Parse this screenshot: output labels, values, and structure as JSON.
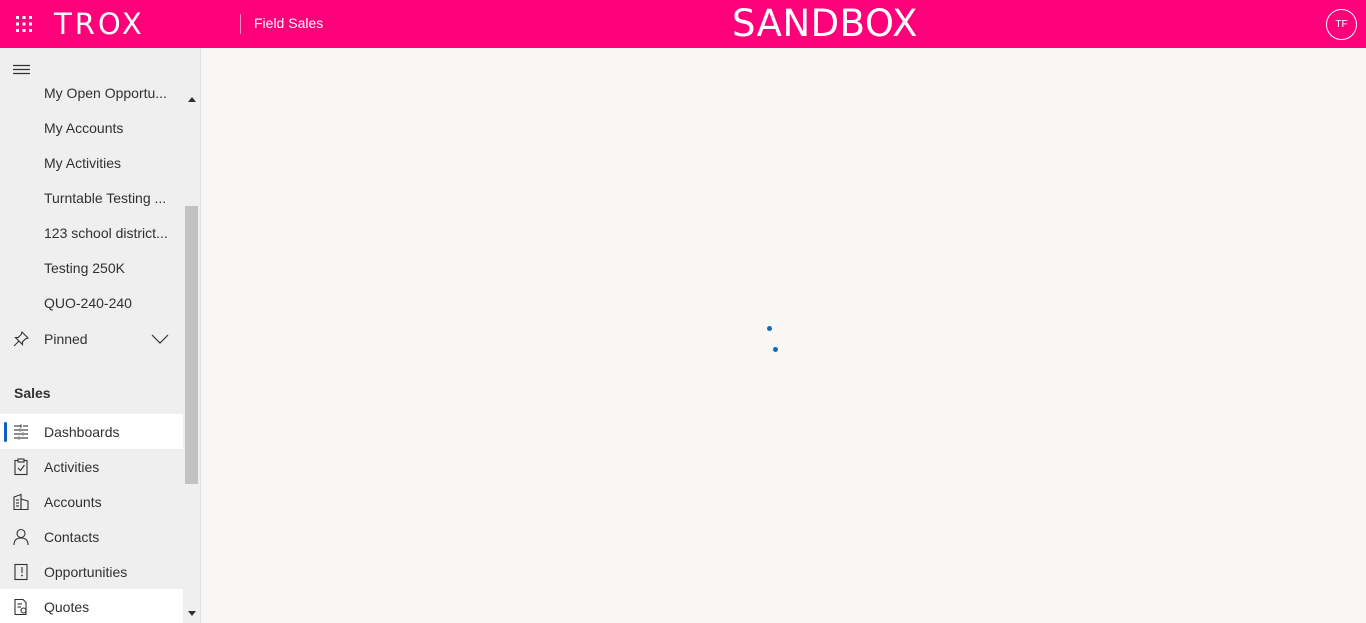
{
  "header": {
    "logo_text": "TROX",
    "app_name": "Field Sales",
    "environment_label": "SANDBOX",
    "avatar_initials": "TF",
    "brand_color": "#ff007b",
    "waffle_icon": "app-launcher-icon"
  },
  "sidebar": {
    "recent_items": [
      {
        "label": "My Open Opportu..."
      },
      {
        "label": "My Accounts"
      },
      {
        "label": "My Activities"
      },
      {
        "label": "Turntable Testing ..."
      },
      {
        "label": "123 school district..."
      },
      {
        "label": "Testing 250K"
      },
      {
        "label": "QUO-240-240"
      }
    ],
    "pinned": {
      "label": "Pinned",
      "icon": "pin-icon"
    },
    "section_title": "Sales",
    "sales_items": [
      {
        "label": "Dashboards",
        "icon": "dashboard-icon",
        "active": true
      },
      {
        "label": "Activities",
        "icon": "activities-icon"
      },
      {
        "label": "Accounts",
        "icon": "accounts-icon"
      },
      {
        "label": "Contacts",
        "icon": "contact-icon"
      },
      {
        "label": "Opportunities",
        "icon": "opportunities-icon"
      },
      {
        "label": "Quotes",
        "icon": "quotes-icon"
      }
    ]
  },
  "main": {
    "state": "loading",
    "spinner_color": "#0f6cbd"
  }
}
